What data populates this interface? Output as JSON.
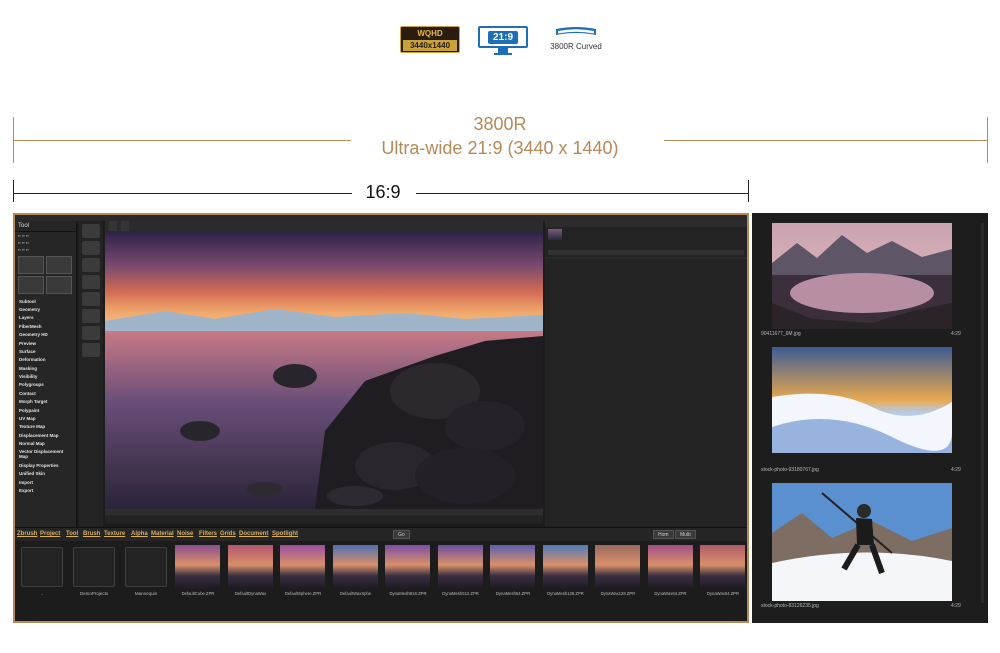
{
  "badges": {
    "wqhd_top": "WQHD",
    "wqhd_res": "3440x1440",
    "ratio": "21:9",
    "curved_label": "3800R Curved"
  },
  "dimensions": {
    "curvature": "3800R",
    "ultrawide": "Ultra-wide 21:9 (3440 x 1440)",
    "standard": "16:9"
  },
  "colors": {
    "accent": "#b48a5a",
    "wqhd_gold": "#c8a23a",
    "ratio_blue": "#1f6fb8",
    "app_bg": "#1c1c1c",
    "panel2_bg": "#1d1d1d"
  },
  "app": {
    "left_panel": {
      "title": "Tool",
      "items": [
        "Subtool",
        "Geometry",
        "Layers",
        "FiberMesh",
        "Geometry HD",
        "Preview",
        "Surface",
        "Deformation",
        "Masking",
        "Visibility",
        "Polygroups",
        "Contact",
        "Morph Target",
        "Polypaint",
        "UV Map",
        "Texture Map",
        "Displacement Map",
        "Normal Map",
        "Vector Displacement Map",
        "Display Properties",
        "Unified Skin",
        "Import",
        "Export"
      ]
    },
    "browser_tabs": [
      "Zbrush",
      "Project",
      "Tool",
      "Brush",
      "Texture",
      "Alpha",
      "Material",
      "Noise",
      "Filters",
      "Grids",
      "Document",
      "Spotlight"
    ],
    "browser_buttons": [
      "Go",
      "Hom",
      "Multi"
    ],
    "folders": [
      "..",
      "DemoProjects",
      "Mannequin"
    ],
    "thumbnails": [
      "DefaultCube.ZPR",
      "DefaultDynaWax",
      "DefaultSphere.ZPR",
      "DefaultWaxSphe",
      "DynaMeshB16.ZPR",
      "DynaMesh512.ZPR",
      "DynaMesh64.ZPR",
      "DynaMesh128.ZPR",
      "DynaWax128.ZPR",
      "DynaWax64.ZPR",
      "DynaWax64.ZPR"
    ]
  },
  "panel2": {
    "images": [
      {
        "name": "90411677_6M.jpg",
        "time": "4:29"
      },
      {
        "name": "stock-photo-93180767.jpg",
        "time": "4:29"
      },
      {
        "name": "stock-photo-83126235.jpg",
        "time": "4:29"
      }
    ]
  }
}
